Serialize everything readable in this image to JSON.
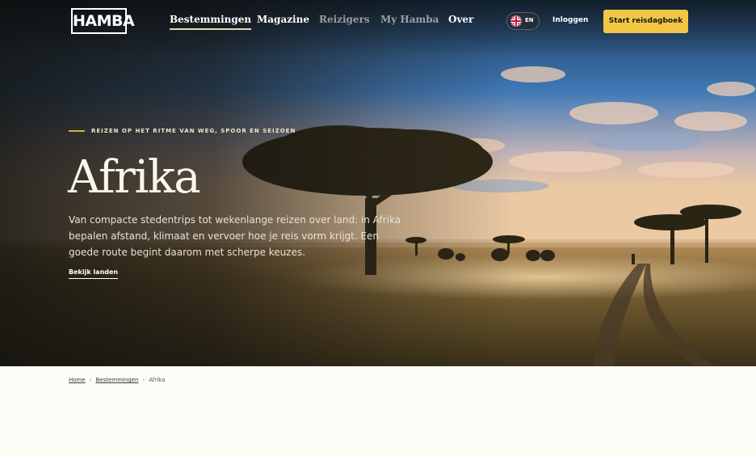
{
  "brand": {
    "logo_text": "HAMBA"
  },
  "nav": {
    "items": [
      {
        "label": "Bestemmingen",
        "state": "active"
      },
      {
        "label": "Magazine",
        "state": "normal"
      },
      {
        "label": "Reizigers",
        "state": "dim"
      },
      {
        "label": "My Hamba",
        "state": "dim"
      },
      {
        "label": "Over",
        "state": "normal"
      }
    ],
    "language": {
      "code": "EN",
      "flag_icon": "uk-flag-icon"
    },
    "login_label": "Inloggen",
    "cta_label": "Start reisdagboek"
  },
  "hero": {
    "kicker": "REIZEN OP HET RITME VAN WEG, SPOOR EN SEIZOEN",
    "title": "Afrika",
    "intro": "Van compacte stedentrips tot wekenlange reizen over land: in Afrika bepalen afstand, klimaat en vervoer hoe je reis vorm krijgt. Een goede route begint daarom met scherpe keuzes.",
    "link_label": "Bekijk landen"
  },
  "breadcrumb": {
    "items": [
      "Home",
      "Bestemmingen",
      "Afrika"
    ],
    "separator": "›"
  },
  "colors": {
    "accent": "#f2c745",
    "background": "#fdfcf6"
  }
}
